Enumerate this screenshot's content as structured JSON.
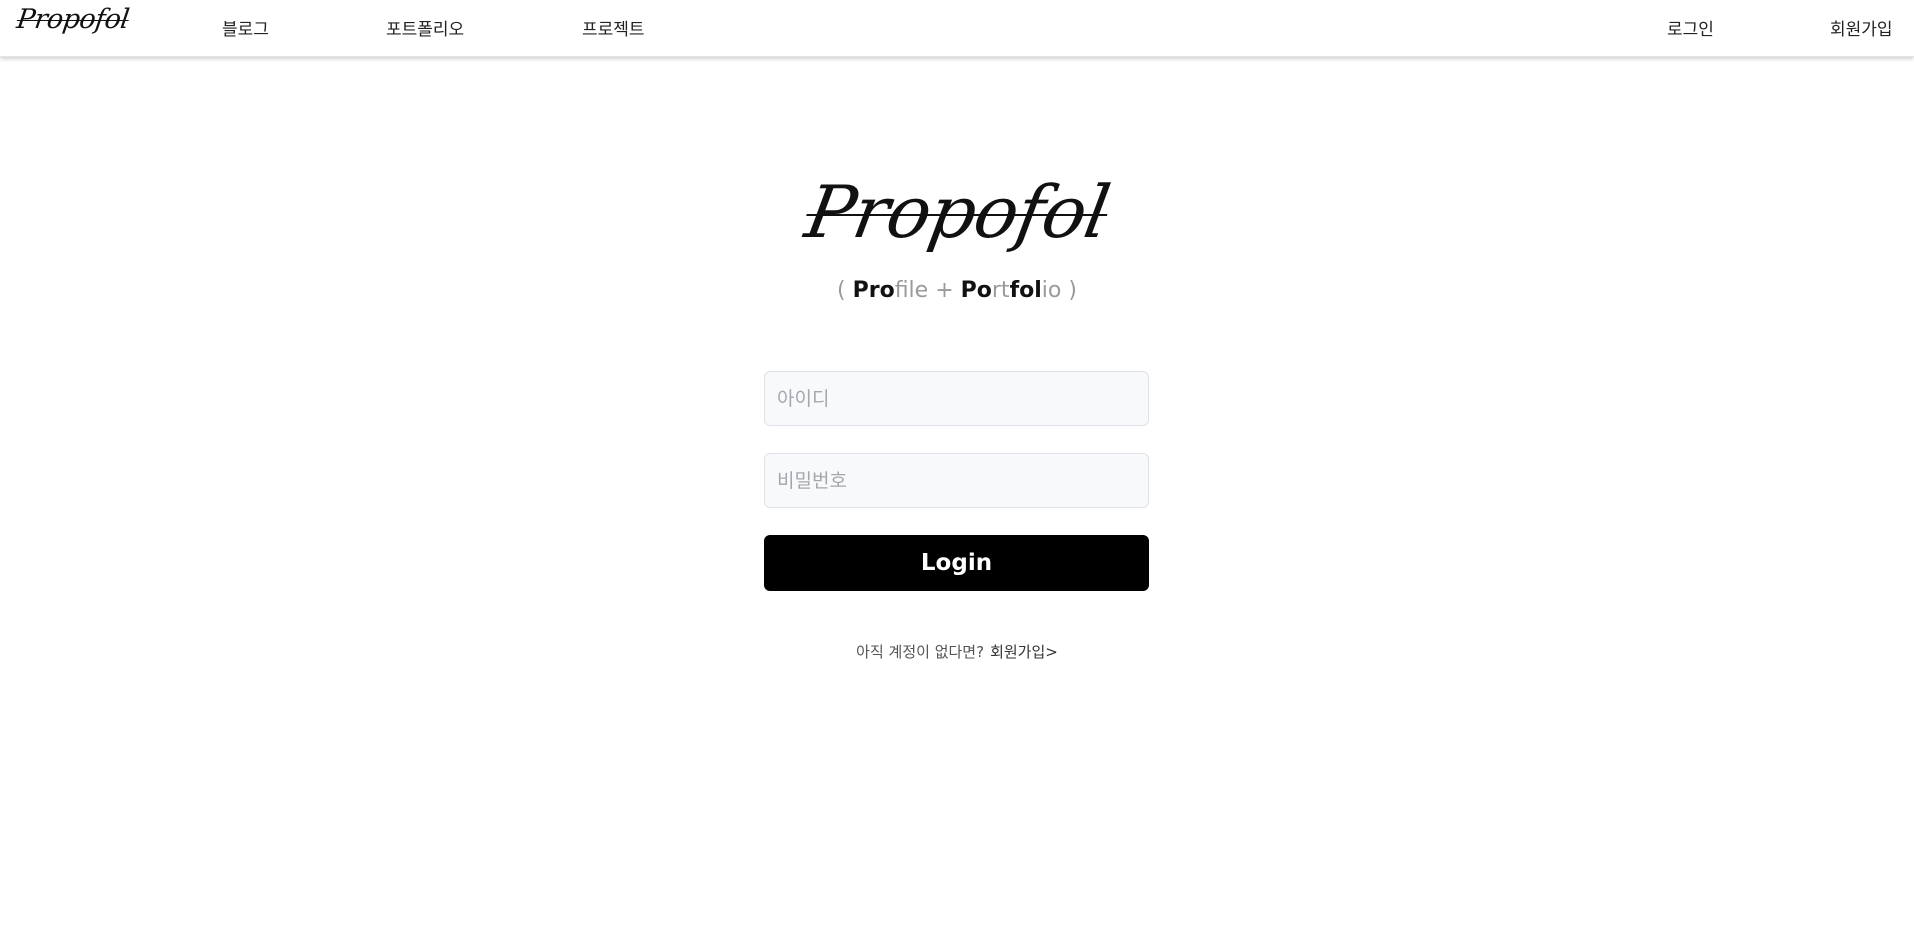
{
  "nav": {
    "logo": "Propofol",
    "links": [
      "블로그",
      "포트폴리오",
      "프로젝트"
    ],
    "login": "로그인",
    "signup": "회원가입"
  },
  "hero": {
    "logo": "Propofol",
    "tagline": {
      "open": "( ",
      "pro": "Pro",
      "file": "file",
      "plus": " + ",
      "po": "Po",
      "rt": "rt",
      "fol": "fol",
      "io": "io",
      "close": " )"
    }
  },
  "form": {
    "id_placeholder": "아이디",
    "id_value": "",
    "password_placeholder": "비밀번호",
    "password_value": "",
    "login_label": "Login"
  },
  "signup_prompt": {
    "text": "아직 계정이 없다면?",
    "link": "회원가입>"
  },
  "colors": {
    "button_bg": "#000000",
    "input_bg": "#f8f9fb",
    "muted_text": "#9a9a9a"
  }
}
